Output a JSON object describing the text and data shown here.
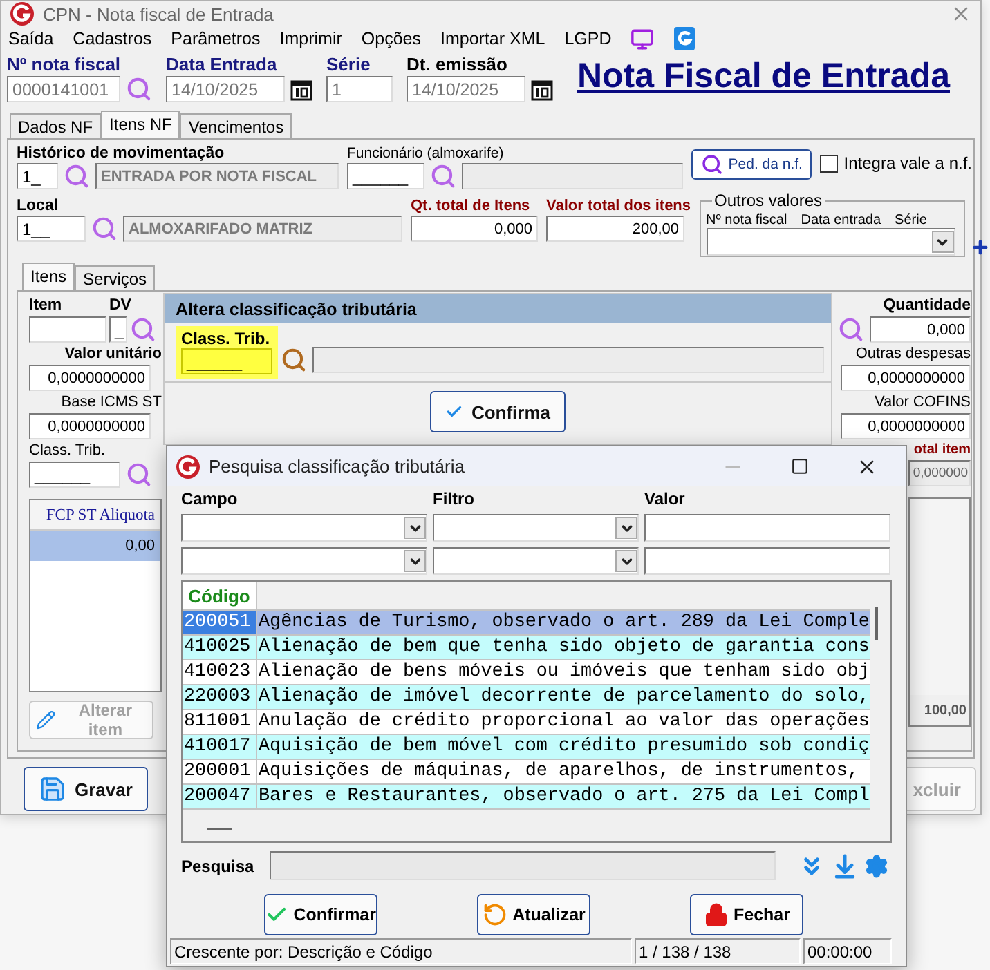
{
  "window": {
    "title": "CPN - Nota fiscal de Entrada"
  },
  "menu": [
    "Saída",
    "Cadastros",
    "Parâmetros",
    "Imprimir",
    "Opções",
    "Importar XML",
    "LGPD"
  ],
  "header": {
    "fields": [
      {
        "label": "Nº nota fiscal",
        "value": "0000141001",
        "kind": "search",
        "highlighted": true,
        "disabled": true
      },
      {
        "label": "Data Entrada",
        "value": "14/10/2025",
        "kind": "date",
        "highlighted": true,
        "disabled": true
      },
      {
        "label": "Série",
        "value": "1",
        "kind": "plain",
        "highlighted": true,
        "disabled": true
      },
      {
        "label": "Dt. emissão",
        "value": "14/10/2025",
        "kind": "date",
        "highlighted": false,
        "disabled": true
      }
    ],
    "title": "Nota Fiscal de Entrada"
  },
  "tabs": [
    {
      "label": "Dados NF",
      "selected": false
    },
    {
      "label": "Itens NF",
      "selected": true
    },
    {
      "label": "Vencimentos",
      "selected": false
    }
  ],
  "movement": {
    "label": "Histórico de movimentação",
    "code": "1_",
    "description": "ENTRADA POR NOTA FISCAL"
  },
  "employee": {
    "label": "Funcionário (almoxarife)",
    "value": "______"
  },
  "order_button": "Ped. da n.f.",
  "integrate": {
    "label": "Integra vale a n.f.",
    "checked": false
  },
  "location": {
    "label": "Local",
    "code": "1__",
    "description": "ALMOXARIFADO MATRIZ"
  },
  "totals": [
    {
      "label": "Qt. total de Itens",
      "value": "0,000"
    },
    {
      "label": "Valor total dos itens",
      "value": "200,00"
    }
  ],
  "other_values": {
    "title": "Outros valores",
    "columns": [
      "Nº nota fiscal",
      "Data entrada",
      "Série"
    ]
  },
  "inner_tabs": [
    {
      "label": "Itens",
      "selected": true
    },
    {
      "label": "Serviços",
      "selected": false
    }
  ],
  "item": {
    "item_label": "Item",
    "dv_label": "DV",
    "dv_value": "_",
    "left_fields": [
      {
        "label": "Valor unitário",
        "value": "0,0000000000",
        "bold": true
      },
      {
        "label": "Base ICMS ST",
        "value": "0,0000000000",
        "bold": false
      }
    ],
    "class_label": "Class. Trib.",
    "class_value": "______",
    "grid": {
      "columns": [
        "FCP ST Aliquota"
      ],
      "rows": [
        {
          "cells": [
            "0,00"
          ],
          "selected": true
        }
      ]
    },
    "edit_button": {
      "label": "Alterar item",
      "disabled": true
    },
    "quantity": {
      "label": "Quantidade",
      "value": "0,000"
    },
    "right_fields": [
      {
        "label": "Outras despesas",
        "value": "0,0000000000"
      },
      {
        "label": "Valor COFINS",
        "value": "0,0000000000"
      }
    ],
    "total_item": {
      "label": "otal item",
      "value": "0,000000"
    },
    "right_grid_value": "100,00"
  },
  "buttons": [
    {
      "label": "Gravar",
      "kind": "save",
      "disabled": false
    },
    {
      "label": "xcluir",
      "kind": "delete",
      "disabled": true
    }
  ],
  "class_panel": {
    "title": "Altera classificação tributária",
    "label": "Class. Trib.",
    "value": "______",
    "confirm": "Confirma"
  },
  "search_dialog": {
    "title": "Pesquisa classificação tributária",
    "filter_headings": [
      "Campo",
      "Filtro",
      "Valor"
    ],
    "column": "Código",
    "rows": [
      {
        "code": "200051",
        "description": "Agências de Turismo, observado o art. 289 da Lei Comple",
        "selected": true
      },
      {
        "code": "410025",
        "description": "Alienação de bem que tenha sido objeto de garantia cons",
        "selected": false
      },
      {
        "code": "410023",
        "description": "Alienação de bens móveis ou imóveis que tenham sido obj",
        "selected": false
      },
      {
        "code": "220003",
        "description": "Alienação de imóvel decorrente de parcelamento do solo,",
        "selected": false
      },
      {
        "code": "811001",
        "description": "Anulação de crédito proporcional ao valor das operações",
        "selected": false
      },
      {
        "code": "410017",
        "description": "Aquisição de bem móvel com crédito presumido sob condiç",
        "selected": false
      },
      {
        "code": "200001",
        "description": "Aquisições de máquinas, de aparelhos, de instrumentos,",
        "selected": false
      },
      {
        "code": "200047",
        "description": "Bares e Restaurantes, observado o art. 275 da Lei Compl",
        "selected": false
      }
    ],
    "search_label": "Pesquisa",
    "buttons": [
      {
        "label": "Confirmar",
        "kind": "confirm"
      },
      {
        "label": "Atualizar",
        "kind": "refresh"
      },
      {
        "label": "Fechar",
        "kind": "close"
      }
    ],
    "status": [
      "Crescente por: Descrição e Código",
      "1 / 138 / 138",
      "00:00:00"
    ]
  }
}
